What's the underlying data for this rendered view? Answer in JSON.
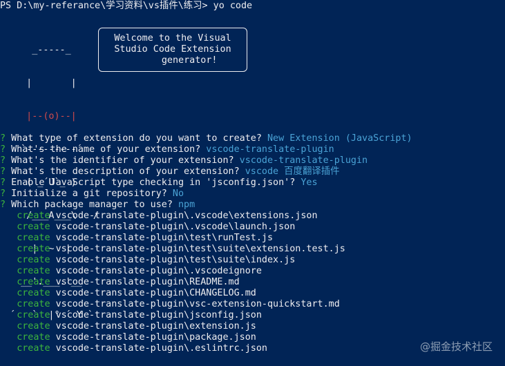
{
  "prompt_line": "PS D:\\my-referance\\学习资料\\vs插件\\练习> yo code",
  "logo": {
    "ascii_lines": [
      "    _-----_     ",
      "   |       |    ",
      "   |--(o)--|    ",
      "  `---------´   ",
      "   ( _´U`_ )    ",
      "   /___A___\\   /",
      "    |  ~  |     ",
      "  __'.___.'__   ",
      "´   `  |° ´ Y ` "
    ],
    "welcome_text": "Welcome to the Visual\nStudio Code Extension\n      generator!"
  },
  "questions": [
    {
      "mark": "?",
      "question": "What type of extension do you want to create?",
      "answer": "New Extension (JavaScript)"
    },
    {
      "mark": "?",
      "question": "What's the name of your extension?",
      "answer": "vscode-translate-plugin"
    },
    {
      "mark": "?",
      "question": "What's the identifier of your extension?",
      "answer": "vscode-translate-plugin"
    },
    {
      "mark": "?",
      "question": "What's the description of your extension?",
      "answer": "vscode 百度翻译插件"
    },
    {
      "mark": "?",
      "question": "Enable JavaScript type checking in 'jsconfig.json'?",
      "answer": "Yes"
    },
    {
      "mark": "?",
      "question": "Initialize a git repository?",
      "answer": "No"
    },
    {
      "mark": "?",
      "question": "Which package manager to use?",
      "answer": "npm"
    }
  ],
  "created_files": [
    {
      "verb": "create",
      "path": "vscode-translate-plugin\\.vscode\\extensions.json"
    },
    {
      "verb": "create",
      "path": "vscode-translate-plugin\\.vscode\\launch.json"
    },
    {
      "verb": "create",
      "path": "vscode-translate-plugin\\test\\runTest.js"
    },
    {
      "verb": "create",
      "path": "vscode-translate-plugin\\test\\suite\\extension.test.js"
    },
    {
      "verb": "create",
      "path": "vscode-translate-plugin\\test\\suite\\index.js"
    },
    {
      "verb": "create",
      "path": "vscode-translate-plugin\\.vscodeignore"
    },
    {
      "verb": "create",
      "path": "vscode-translate-plugin\\README.md"
    },
    {
      "verb": "create",
      "path": "vscode-translate-plugin\\CHANGELOG.md"
    },
    {
      "verb": "create",
      "path": "vscode-translate-plugin\\vsc-extension-quickstart.md"
    },
    {
      "verb": "create",
      "path": "vscode-translate-plugin\\jsconfig.json"
    },
    {
      "verb": "create",
      "path": "vscode-translate-plugin\\extension.js"
    },
    {
      "verb": "create",
      "path": "vscode-translate-plugin\\package.json"
    },
    {
      "verb": "create",
      "path": "vscode-translate-plugin\\.eslintrc.json"
    }
  ],
  "watermark": "@掘金技术社区",
  "colors": {
    "background": "#012456",
    "foreground": "#eeedf0",
    "green": "#3db53d",
    "cyan": "#4aa3d6",
    "red": "#d34b4b",
    "yellow": "#e5c04a"
  }
}
